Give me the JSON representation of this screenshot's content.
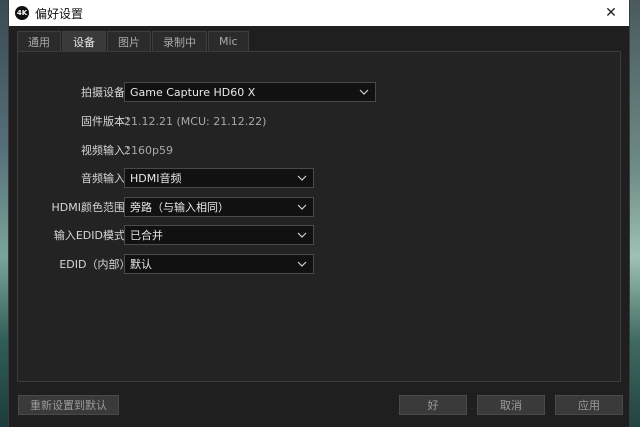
{
  "window": {
    "title": "偏好设置",
    "app_icon_text": "4K",
    "close_glyph": "✕"
  },
  "tabs": [
    {
      "label": "通用",
      "active": false
    },
    {
      "label": "设备",
      "active": true
    },
    {
      "label": "图片",
      "active": false
    },
    {
      "label": "录制中",
      "active": false
    },
    {
      "label": "Mic",
      "active": false
    }
  ],
  "device": {
    "capture_label": "拍摄设备：",
    "capture_value": "Game Capture HD60 X",
    "firmware_label": "固件版本：",
    "firmware_value": "21.12.21 (MCU: 21.12.22)",
    "video_input_label": "视频输入：",
    "video_input_value": "2160p59",
    "audio_input_label": "音频输入：",
    "audio_input_value": "HDMI音频",
    "hdmi_range_label": "HDMI颜色范围：",
    "hdmi_range_value": "旁路（与输入相同）",
    "edid_mode_label": "输入EDID模式：",
    "edid_mode_value": "已合并",
    "edid_internal_label": "EDID（内部）：",
    "edid_internal_value": "默认"
  },
  "footer": {
    "reset_label": "重新设置到默认",
    "ok_label": "好",
    "cancel_label": "取消",
    "apply_label": "应用"
  },
  "icons": {
    "dropdown": "chevron-down-icon",
    "close": "close-icon",
    "app": "app-logo-icon"
  }
}
